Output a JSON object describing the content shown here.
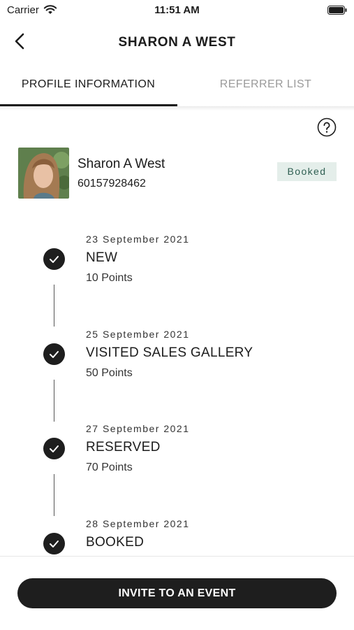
{
  "status_bar": {
    "carrier": "Carrier",
    "time": "11:51 AM"
  },
  "header": {
    "title": "SHARON A WEST",
    "back_icon": "chevron-left-icon"
  },
  "tabs": [
    {
      "label": "PROFILE INFORMATION",
      "active": true
    },
    {
      "label": "REFERRER LIST",
      "active": false
    }
  ],
  "help_icon": "question-circle-icon",
  "profile": {
    "name": "Sharon A West",
    "phone": "60157928462",
    "badge": "Booked"
  },
  "timeline": [
    {
      "date": "23 September 2021",
      "status": "NEW",
      "points": "10 Points"
    },
    {
      "date": "25 September 2021",
      "status": "VISITED SALES GALLERY",
      "points": "50 Points"
    },
    {
      "date": "27 September 2021",
      "status": "RESERVED",
      "points": "70 Points"
    },
    {
      "date": "28 September 2021",
      "status": "BOOKED",
      "points": ""
    }
  ],
  "footer": {
    "cta_label": "INVITE TO AN EVENT"
  },
  "colors": {
    "primary": "#1e1e1e",
    "badge_bg": "#e4eeea",
    "badge_text": "#2f5f52",
    "inactive_tab": "#9a9a9a"
  }
}
